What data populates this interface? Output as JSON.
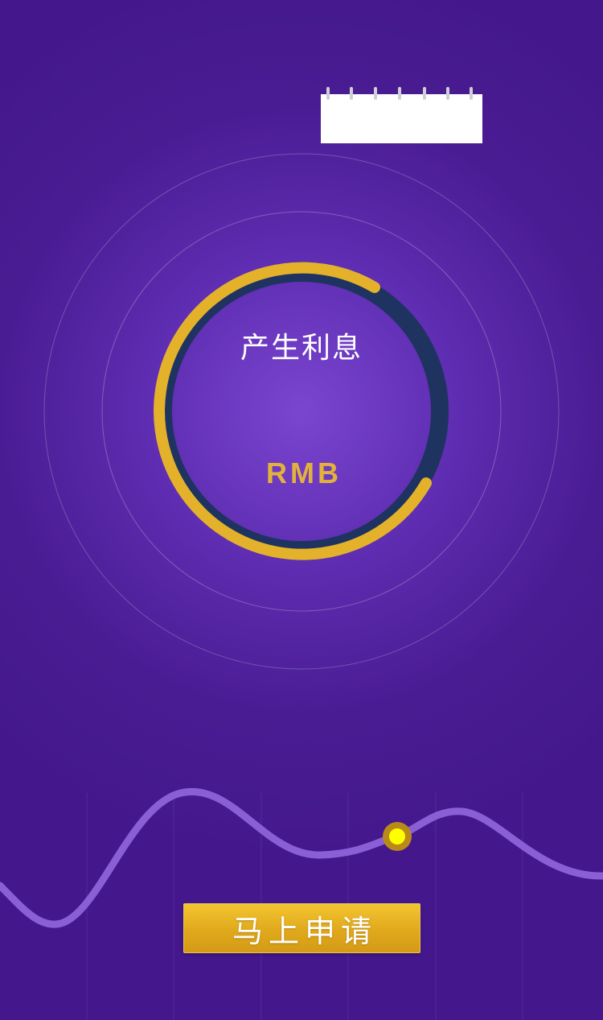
{
  "circle": {
    "label": "产生利息",
    "currency": "RMB",
    "progress_fraction": 0.65
  },
  "actions": {
    "apply_label": "马上申请"
  },
  "colors": {
    "background": "#44188c",
    "background_glow": "#7a45d0",
    "ring_gold": "#e4b22a",
    "ring_track": "#1e3360",
    "wave": "#8a5fd6",
    "marker": "#ffff00",
    "button_gold": "#e0a91c"
  }
}
